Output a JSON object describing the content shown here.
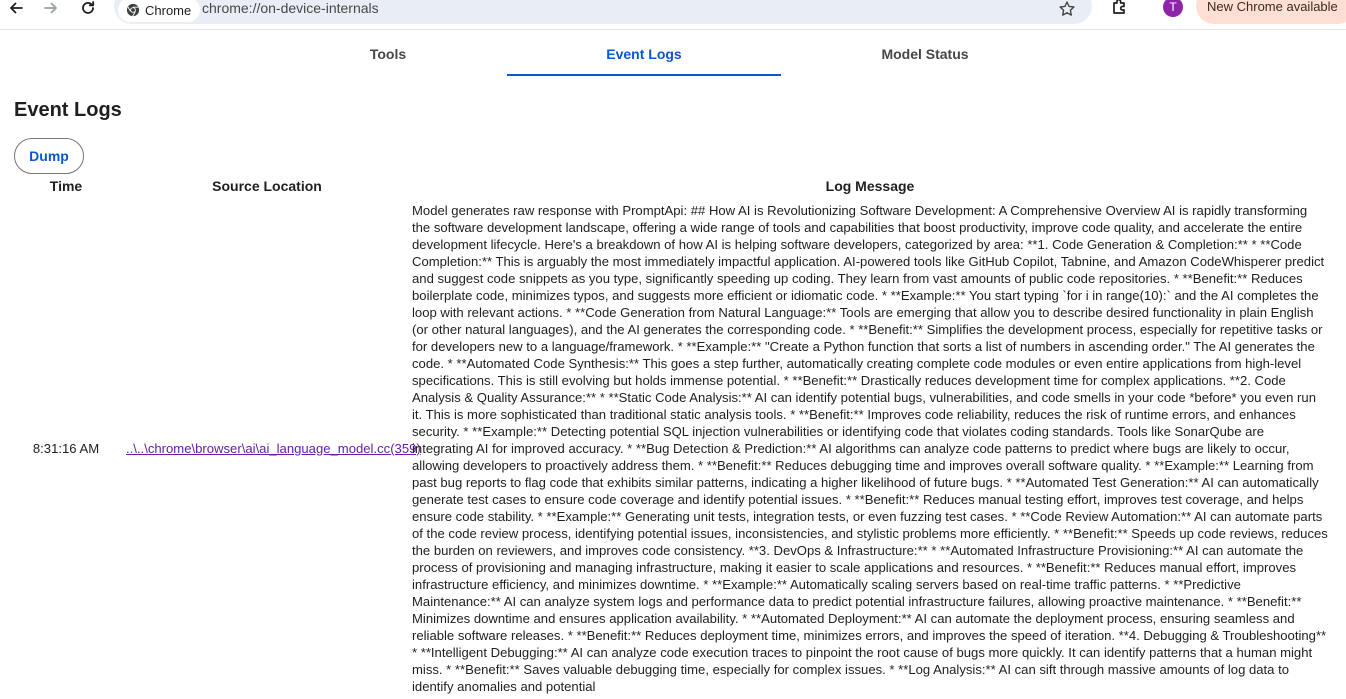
{
  "browser": {
    "chip_label": "Chrome",
    "url": "chrome://on-device-internals",
    "avatar_initial": "T",
    "update_label": "New Chrome available",
    "accent": "#0b57d0"
  },
  "tabs": [
    {
      "label": "Tools",
      "active": false
    },
    {
      "label": "Event Logs",
      "active": true
    },
    {
      "label": "Model Status",
      "active": false
    }
  ],
  "page": {
    "title": "Event Logs",
    "dump_label": "Dump"
  },
  "table": {
    "headers": [
      "Time",
      "Source Location",
      "Log Message"
    ],
    "rows": [
      {
        "time": "8:31:16 AM",
        "source": "..\\..\\chrome\\browser\\ai\\ai_language_model.cc(359)",
        "message": "Model generates raw response with PromptApi: ## How AI is Revolutionizing Software Development: A Comprehensive Overview AI is rapidly transforming the software development landscape, offering a wide range of tools and capabilities that boost productivity, improve code quality, and accelerate the entire development lifecycle. Here's a breakdown of how AI is helping software developers, categorized by area: **1. Code Generation & Completion:** * **Code Completion:** This is arguably the most immediately impactful application. AI-powered tools like GitHub Copilot, Tabnine, and Amazon CodeWhisperer predict and suggest code snippets as you type, significantly speeding up coding. They learn from vast amounts of public code repositories. * **Benefit:** Reduces boilerplate code, minimizes typos, and suggests more efficient or idiomatic code. * **Example:** You start typing `for i in range(10):` and the AI completes the loop with relevant actions. * **Code Generation from Natural Language:** Tools are emerging that allow you to describe desired functionality in plain English (or other natural languages), and the AI generates the corresponding code. * **Benefit:** Simplifies the development process, especially for repetitive tasks or for developers new to a language/framework. * **Example:** \"Create a Python function that sorts a list of numbers in ascending order.\" The AI generates the code. * **Automated Code Synthesis:** This goes a step further, automatically creating complete code modules or even entire applications from high-level specifications. This is still evolving but holds immense potential. * **Benefit:** Drastically reduces development time for complex applications. **2. Code Analysis & Quality Assurance:** * **Static Code Analysis:** AI can identify potential bugs, vulnerabilities, and code smells in your code *before* you even run it. This is more sophisticated than traditional static analysis tools. * **Benefit:** Improves code reliability, reduces the risk of runtime errors, and enhances security. * **Example:** Detecting potential SQL injection vulnerabilities or identifying code that violates coding standards. Tools like SonarQube are integrating AI for improved accuracy. * **Bug Detection & Prediction:** AI algorithms can analyze code patterns to predict where bugs are likely to occur, allowing developers to proactively address them. * **Benefit:** Reduces debugging time and improves overall software quality. * **Example:** Learning from past bug reports to flag code that exhibits similar patterns, indicating a higher likelihood of future bugs. * **Automated Test Generation:** AI can automatically generate test cases to ensure code coverage and identify potential issues. * **Benefit:** Reduces manual testing effort, improves test coverage, and helps ensure code stability. * **Example:** Generating unit tests, integration tests, or even fuzzing test cases. * **Code Review Automation:** AI can automate parts of the code review process, identifying potential issues, inconsistencies, and stylistic problems more efficiently. * **Benefit:** Speeds up code reviews, reduces the burden on reviewers, and improves code consistency. **3. DevOps & Infrastructure:** * **Automated Infrastructure Provisioning:** AI can automate the process of provisioning and managing infrastructure, making it easier to scale applications and resources. * **Benefit:** Reduces manual effort, improves infrastructure efficiency, and minimizes downtime. * **Example:** Automatically scaling servers based on real-time traffic patterns. * **Predictive Maintenance:** AI can analyze system logs and performance data to predict potential infrastructure failures, allowing proactive maintenance. * **Benefit:** Minimizes downtime and ensures application availability. * **Automated Deployment:** AI can automate the deployment process, ensuring seamless and reliable software releases. * **Benefit:** Reduces deployment time, minimizes errors, and improves the speed of iteration. **4. Debugging & Troubleshooting** * **Intelligent Debugging:** AI can analyze code execution traces to pinpoint the root cause of bugs more quickly. It can identify patterns that a human might miss. * **Benefit:** Saves valuable debugging time, especially for complex issues. * **Log Analysis:** AI can sift through massive amounts of log data to identify anomalies and potential"
      }
    ]
  }
}
